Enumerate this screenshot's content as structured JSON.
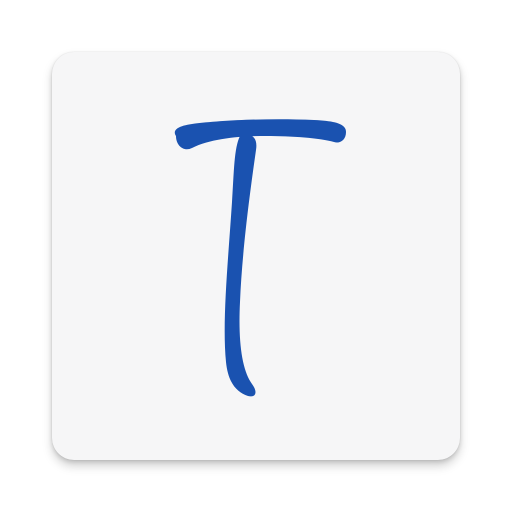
{
  "app_icon": {
    "icon": "handwritten-letter-t-icon",
    "letter": "T",
    "background_color": "#f6f6f7",
    "glyph_color": "#1a52b0"
  }
}
